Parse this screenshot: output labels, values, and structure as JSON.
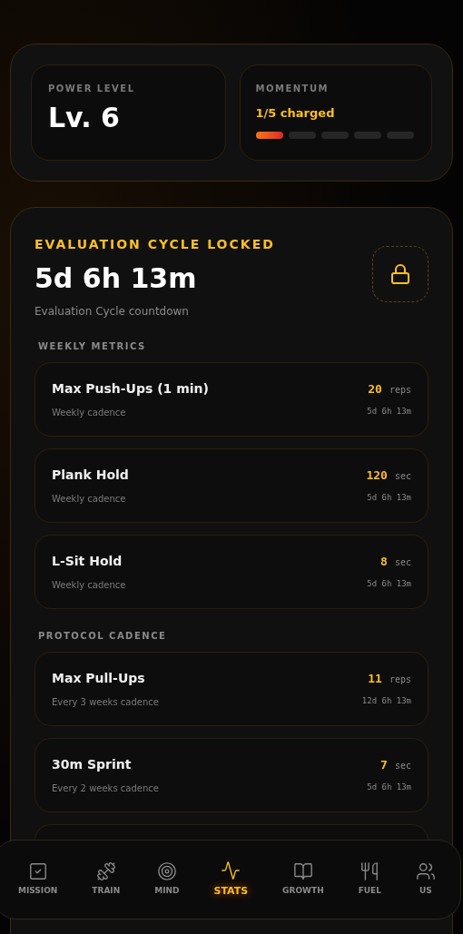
{
  "power": {
    "label": "POWER LEVEL",
    "value": "Lv. 6"
  },
  "momentum": {
    "label": "MOMENTUM",
    "status": "1/5 charged",
    "segments": [
      {
        "on": true
      },
      {
        "on": false
      },
      {
        "on": false
      },
      {
        "on": false
      },
      {
        "on": false
      }
    ]
  },
  "evaluation": {
    "title": "EVALUATION CYCLE LOCKED",
    "countdown": "5d 6h 13m",
    "caption": "Evaluation Cycle countdown",
    "locked": true
  },
  "sections": [
    {
      "heading": "WEEKLY METRICS",
      "metrics": [
        {
          "name": "Max Push-Ups (1 min)",
          "cadence": "Weekly cadence",
          "value": "20",
          "unit": "reps",
          "timer": "5d 6h 13m"
        },
        {
          "name": "Plank Hold",
          "cadence": "Weekly cadence",
          "value": "120",
          "unit": "sec",
          "timer": "5d 6h 13m"
        },
        {
          "name": "L-Sit Hold",
          "cadence": "Weekly cadence",
          "value": "8",
          "unit": "sec",
          "timer": "5d 6h 13m"
        }
      ]
    },
    {
      "heading": "PROTOCOL CADENCE",
      "metrics": [
        {
          "name": "Max Pull-Ups",
          "cadence": "Every 3 weeks cadence",
          "value": "11",
          "unit": "reps",
          "timer": "12d 6h 13m"
        },
        {
          "name": "30m Sprint",
          "cadence": "Every 2 weeks cadence",
          "value": "7",
          "unit": "sec",
          "timer": "5d 6h 13m"
        }
      ]
    }
  ],
  "nav": [
    {
      "label": "MISSION",
      "selected": false
    },
    {
      "label": "TRAIN",
      "selected": false
    },
    {
      "label": "MIND",
      "selected": false
    },
    {
      "label": "STATS",
      "selected": true
    },
    {
      "label": "GROWTH",
      "selected": false
    },
    {
      "label": "FUEL",
      "selected": false
    },
    {
      "label": "US",
      "selected": false
    }
  ]
}
